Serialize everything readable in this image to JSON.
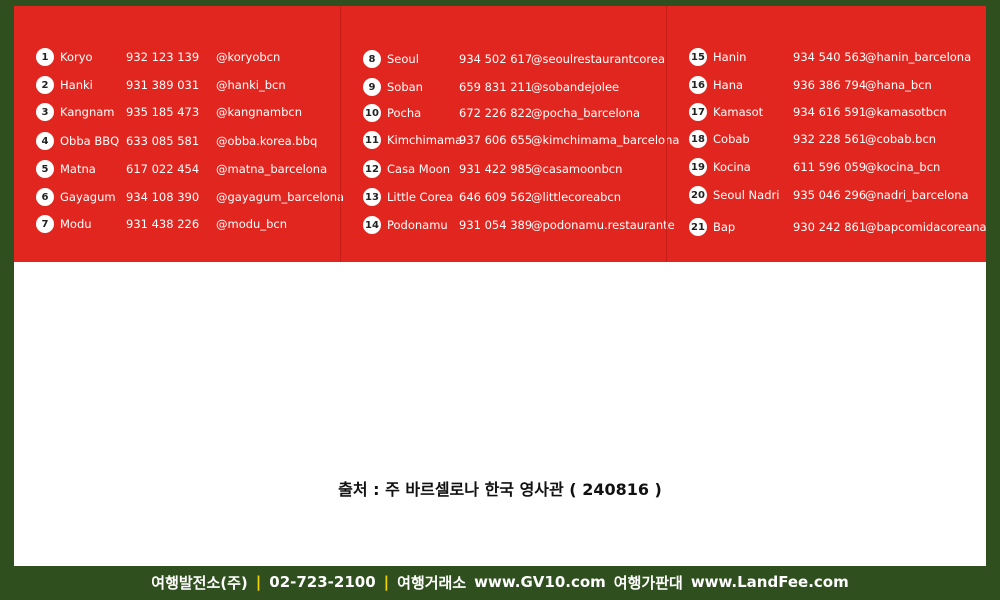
{
  "colors": {
    "card_bg": "#e0261f",
    "page_bg": "#2f4f1e",
    "separator": "#f5d400"
  },
  "restaurants": [
    {
      "n": "1",
      "name": "Koryo",
      "phone": "932 123 139",
      "handle": "@koryobcn"
    },
    {
      "n": "2",
      "name": "Hanki",
      "phone": "931 389 031",
      "handle": "@hanki_bcn"
    },
    {
      "n": "3",
      "name": "Kangnam",
      "phone": "935 185 473",
      "handle": "@kangnambcn"
    },
    {
      "n": "4",
      "name": "Obba BBQ",
      "phone": "633 085 581",
      "handle": "@obba.korea.bbq"
    },
    {
      "n": "5",
      "name": "Matna",
      "phone": "617 022 454",
      "handle": "@matna_barcelona"
    },
    {
      "n": "6",
      "name": "Gayagum",
      "phone": "934 108 390",
      "handle": "@gayagum_barcelona"
    },
    {
      "n": "7",
      "name": "Modu",
      "phone": "931 438 226",
      "handle": "@modu_bcn"
    },
    {
      "n": "8",
      "name": "Seoul",
      "phone": "934 502 617",
      "handle": "@seoulrestaurantcorea"
    },
    {
      "n": "9",
      "name": "Soban",
      "phone": "659 831 211",
      "handle": "@sobandejolee"
    },
    {
      "n": "10",
      "name": "Pocha",
      "phone": "672 226 822",
      "handle": "@pocha_barcelona"
    },
    {
      "n": "11",
      "name": "Kimchimama",
      "phone": "937 606 655",
      "handle": "@kimchimama_barcelona"
    },
    {
      "n": "12",
      "name": "Casa Moon",
      "phone": "931 422 985",
      "handle": "@casamoonbcn"
    },
    {
      "n": "13",
      "name": "Little Corea",
      "phone": "646 609 562",
      "handle": "@littlecoreabcn"
    },
    {
      "n": "14",
      "name": "Podonamu",
      "phone": "931 054 389",
      "handle": "@podonamu.restaurante"
    },
    {
      "n": "15",
      "name": "Hanin",
      "phone": "934 540 563",
      "handle": "@hanin_barcelona"
    },
    {
      "n": "16",
      "name": "Hana",
      "phone": "936 386 794",
      "handle": "@hana_bcn"
    },
    {
      "n": "17",
      "name": "Kamasot",
      "phone": "934 616 591",
      "handle": "@kamasotbcn"
    },
    {
      "n": "18",
      "name": "Cobab",
      "phone": "932 228 561",
      "handle": "@cobab.bcn"
    },
    {
      "n": "19",
      "name": "Kocina",
      "phone": "611 596 059",
      "handle": "@kocina_bcn"
    },
    {
      "n": "20",
      "name": "Seoul Nadri",
      "phone": "935 046 296",
      "handle": "@nadri_barcelona"
    },
    {
      "n": "21",
      "name": "Bap",
      "phone": "930 242 861",
      "handle": "@bapcomidacoreana"
    }
  ],
  "source_text": "출처 : 주 바르셀로나 한국 영사관 ( 240816 )",
  "footer": {
    "company": "여행발전소(주)",
    "sep": "|",
    "phone": "02-723-2100",
    "label1": "여행거래소",
    "url1": "www.GV10.com",
    "label2": "여행가판대",
    "url2": "www.LandFee.com"
  }
}
